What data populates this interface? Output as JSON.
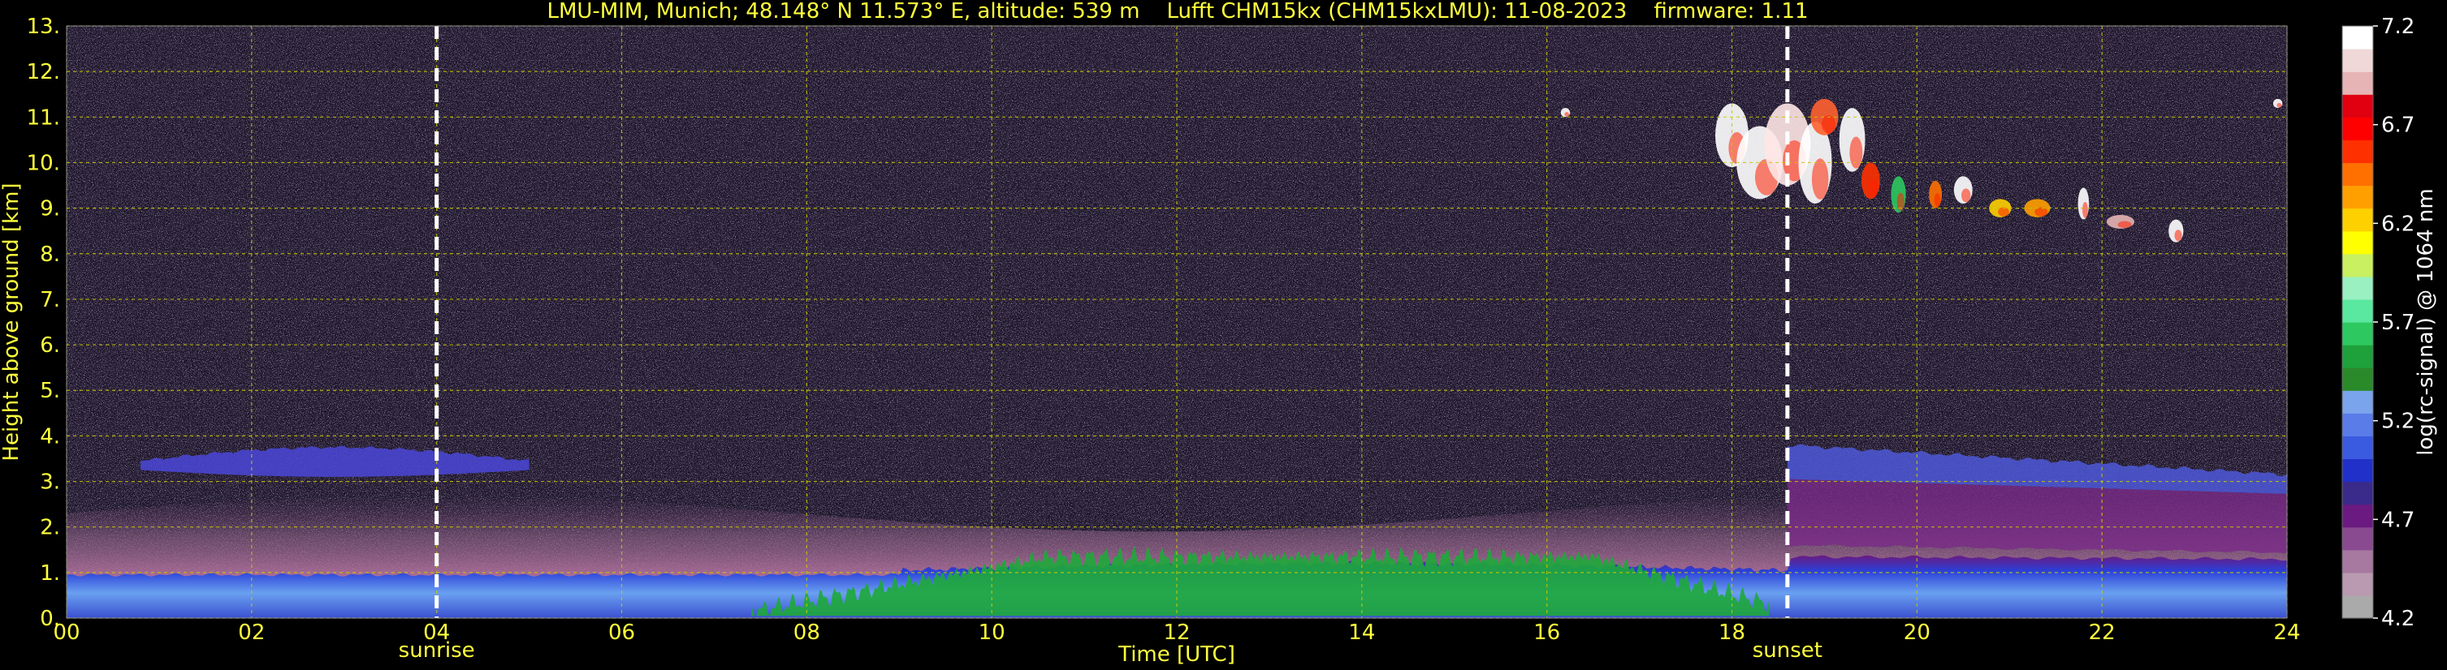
{
  "chart_data": {
    "type": "heatmap",
    "title": "LMU-MIM, Munich; 48.148° N 11.573° E, altitude: 539 m    Lufft CHM15kx (CHM15kxLMU): 11-08-2023    firmware: 1.11",
    "xlabel": "Time [UTC]",
    "ylabel": "Height above ground [km]",
    "xlim": [
      0,
      24
    ],
    "ylim": [
      0,
      13
    ],
    "x_ticks": [
      "00",
      "02",
      "04",
      "06",
      "08",
      "10",
      "12",
      "14",
      "16",
      "18",
      "20",
      "22",
      "24"
    ],
    "y_ticks": [
      "0.",
      "1.",
      "2.",
      "3.",
      "4.",
      "5.",
      "6.",
      "7.",
      "8.",
      "9.",
      "10.",
      "11.",
      "12.",
      "13."
    ],
    "grid": true,
    "markers": [
      {
        "label": "sunrise",
        "x": 4.0
      },
      {
        "label": "sunset",
        "x": 18.6
      }
    ],
    "colorbar": {
      "label": "log(rc-signal) @ 1064 nm",
      "ticks": [
        "4.2",
        "4.7",
        "5.2",
        "5.7",
        "6.2",
        "6.7",
        "7.2"
      ],
      "range": [
        4.2,
        7.2
      ],
      "colors": [
        "#aaaaaa",
        "#b99ab0",
        "#a778a0",
        "#8a4a90",
        "#6a1a80",
        "#3a2a8a",
        "#2030c8",
        "#3a5ae0",
        "#5a7ce8",
        "#7aa4ec",
        "#2a8a2a",
        "#1ea03a",
        "#2ec860",
        "#5ae8a0",
        "#9af0c0",
        "#c8f060",
        "#ffff00",
        "#ffd000",
        "#ffa000",
        "#ff7000",
        "#ff3000",
        "#ff0000",
        "#e00010",
        "#e6b4b4",
        "#f0d8d8",
        "#ffffff"
      ]
    },
    "features": [
      {
        "name": "boundary layer",
        "x": [
          0,
          24
        ],
        "y_top_km": [
          0.9,
          1.0,
          0.9,
          1.4,
          1.6,
          1.4,
          1.2
        ]
      },
      {
        "name": "elevated aerosol layer (morning)",
        "x": [
          0.8,
          5.0
        ],
        "y_km": [
          3.1,
          3.7
        ]
      },
      {
        "name": "elevated aerosol layer (evening)",
        "x": [
          18.6,
          24
        ],
        "y_km": [
          2.8,
          3.8
        ]
      },
      {
        "name": "cirrus clouds",
        "x": [
          17.8,
          23.0
        ],
        "y_km": [
          8.2,
          11.3
        ]
      }
    ]
  }
}
